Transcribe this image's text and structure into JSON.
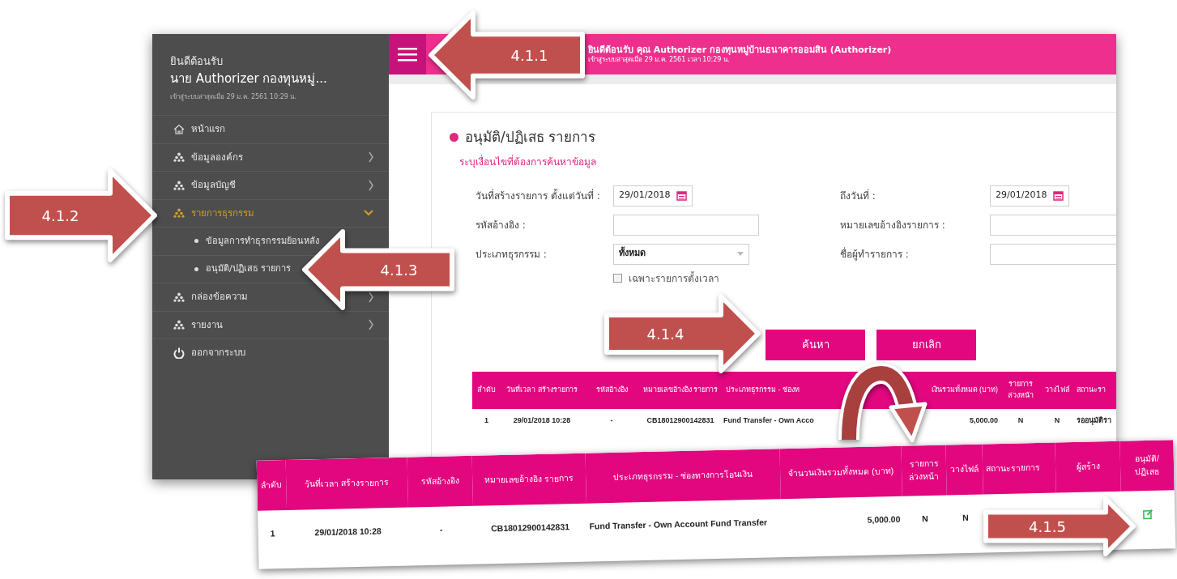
{
  "sidebar": {
    "welcome": "ยินดีต้อนรับ",
    "user": "นาย Authorizer กองทุนหมู่...",
    "last_login": "เข้าสู่ระบบล่าสุดเมื่อ 29 ม.ค. 2561 10:29 น.",
    "items": [
      {
        "kind": "home",
        "label": "หน้าแรก"
      },
      {
        "kind": "group",
        "label": "ข้อมูลองค์กร",
        "expanded": false
      },
      {
        "kind": "group",
        "label": "ข้อมูลบัญชี",
        "expanded": false
      },
      {
        "kind": "group",
        "label": "รายการธุรกรรม",
        "expanded": true,
        "children": [
          {
            "label": "ข้อมูลการทำธุรกรรมย้อนหลัง"
          },
          {
            "label": "อนุมัติ/ปฏิเสธ รายการ"
          }
        ]
      },
      {
        "kind": "group",
        "label": "กล่องข้อความ",
        "expanded": false
      },
      {
        "kind": "group",
        "label": "รายงาน",
        "expanded": false
      },
      {
        "kind": "logout",
        "label": "ออกจากระบบ"
      }
    ]
  },
  "header": {
    "greeting": "ยินดีต้อนรับ คุณ Authorizer กองทุนหมู่บ้านธนาคารออมสิน (Authorizer)",
    "last_login": "เข้าสู่ระบบล่าสุดเมื่อ 29 ม.ค. 2561 เวลา 10:29 น."
  },
  "page": {
    "title": "อนุมัติ/ปฏิเสธ รายการ",
    "subtitle": "ระบุเงื่อนไขที่ต้องการค้นหาข้อมูล",
    "fields": [
      {
        "kind": "date",
        "label": "วันที่สร้างรายการ ตั้งแต่วันที่ :",
        "value": "29/01/2018"
      },
      {
        "kind": "date",
        "label": "ถึงวันที่ :",
        "value": "29/01/2018"
      },
      {
        "kind": "text",
        "label": "รหัสอ้างอิง :"
      },
      {
        "kind": "text",
        "label": "หมายเลขอ้างอิงรายการ :"
      },
      {
        "kind": "select",
        "label": "ประเภทธุรกรรม :",
        "value": "ทั้งหมด"
      },
      {
        "kind": "text",
        "label": "ชื่อผู้ทำรายการ :"
      }
    ],
    "checkbox": {
      "label": "เฉพาะรายการตั้งเวลา",
      "checked": false
    },
    "buttons": [
      "ค้นหา",
      "ยกเลิก"
    ],
    "table": {
      "columns": [
        "ลำดับ",
        "วันที่เวลา สร้างรายการ",
        "รหัสอ้างอิง",
        "หมายเลขอ้างอิง รายการ",
        "ประเภทธุรกรรม - ช่องท",
        "เงินรวมทั้งหมด (บาท)",
        "รายการ ล่วงหน้า",
        "วางไฟล์",
        "สถานะรา"
      ],
      "rows": [
        [
          "1",
          "29/01/2018 10:28",
          "-",
          "CB18012900142831",
          "Fund Transfer - Own Acco",
          "5,000.00",
          "N",
          "N",
          "รออนุมัติรา"
        ]
      ]
    }
  },
  "zoomed_table": {
    "columns": [
      "ลำดับ",
      "วันที่เวลา สร้างรายการ",
      "รหัสอ้างอิง",
      "หมายเลขอ้างอิง รายการ",
      "ประเภทธุรกรรม - ช่องทางการโอนเงิน",
      "จำนวนเงินรวมทั้งหมด (บาท)",
      "รายการ ล่วงหน้า",
      "วางไฟล์",
      "สถานะรายการ",
      "ผู้สร้าง",
      "อนุมัติ/ ปฏิเสธ"
    ],
    "rows": [
      [
        "1",
        "29/01/2018 10:28",
        "-",
        "CB18012900142831",
        "Fund Transfer - Own Account Fund Transfer",
        "5,000.00",
        "N",
        "N"
      ]
    ]
  },
  "annotations": [
    {
      "label": "4.1.1",
      "kind": "left"
    },
    {
      "label": "4.1.2",
      "kind": "right"
    },
    {
      "label": "4.1.3",
      "kind": "left"
    },
    {
      "label": "4.1.4",
      "kind": "right"
    },
    {
      "label": "4.1.5",
      "kind": "right"
    }
  ]
}
